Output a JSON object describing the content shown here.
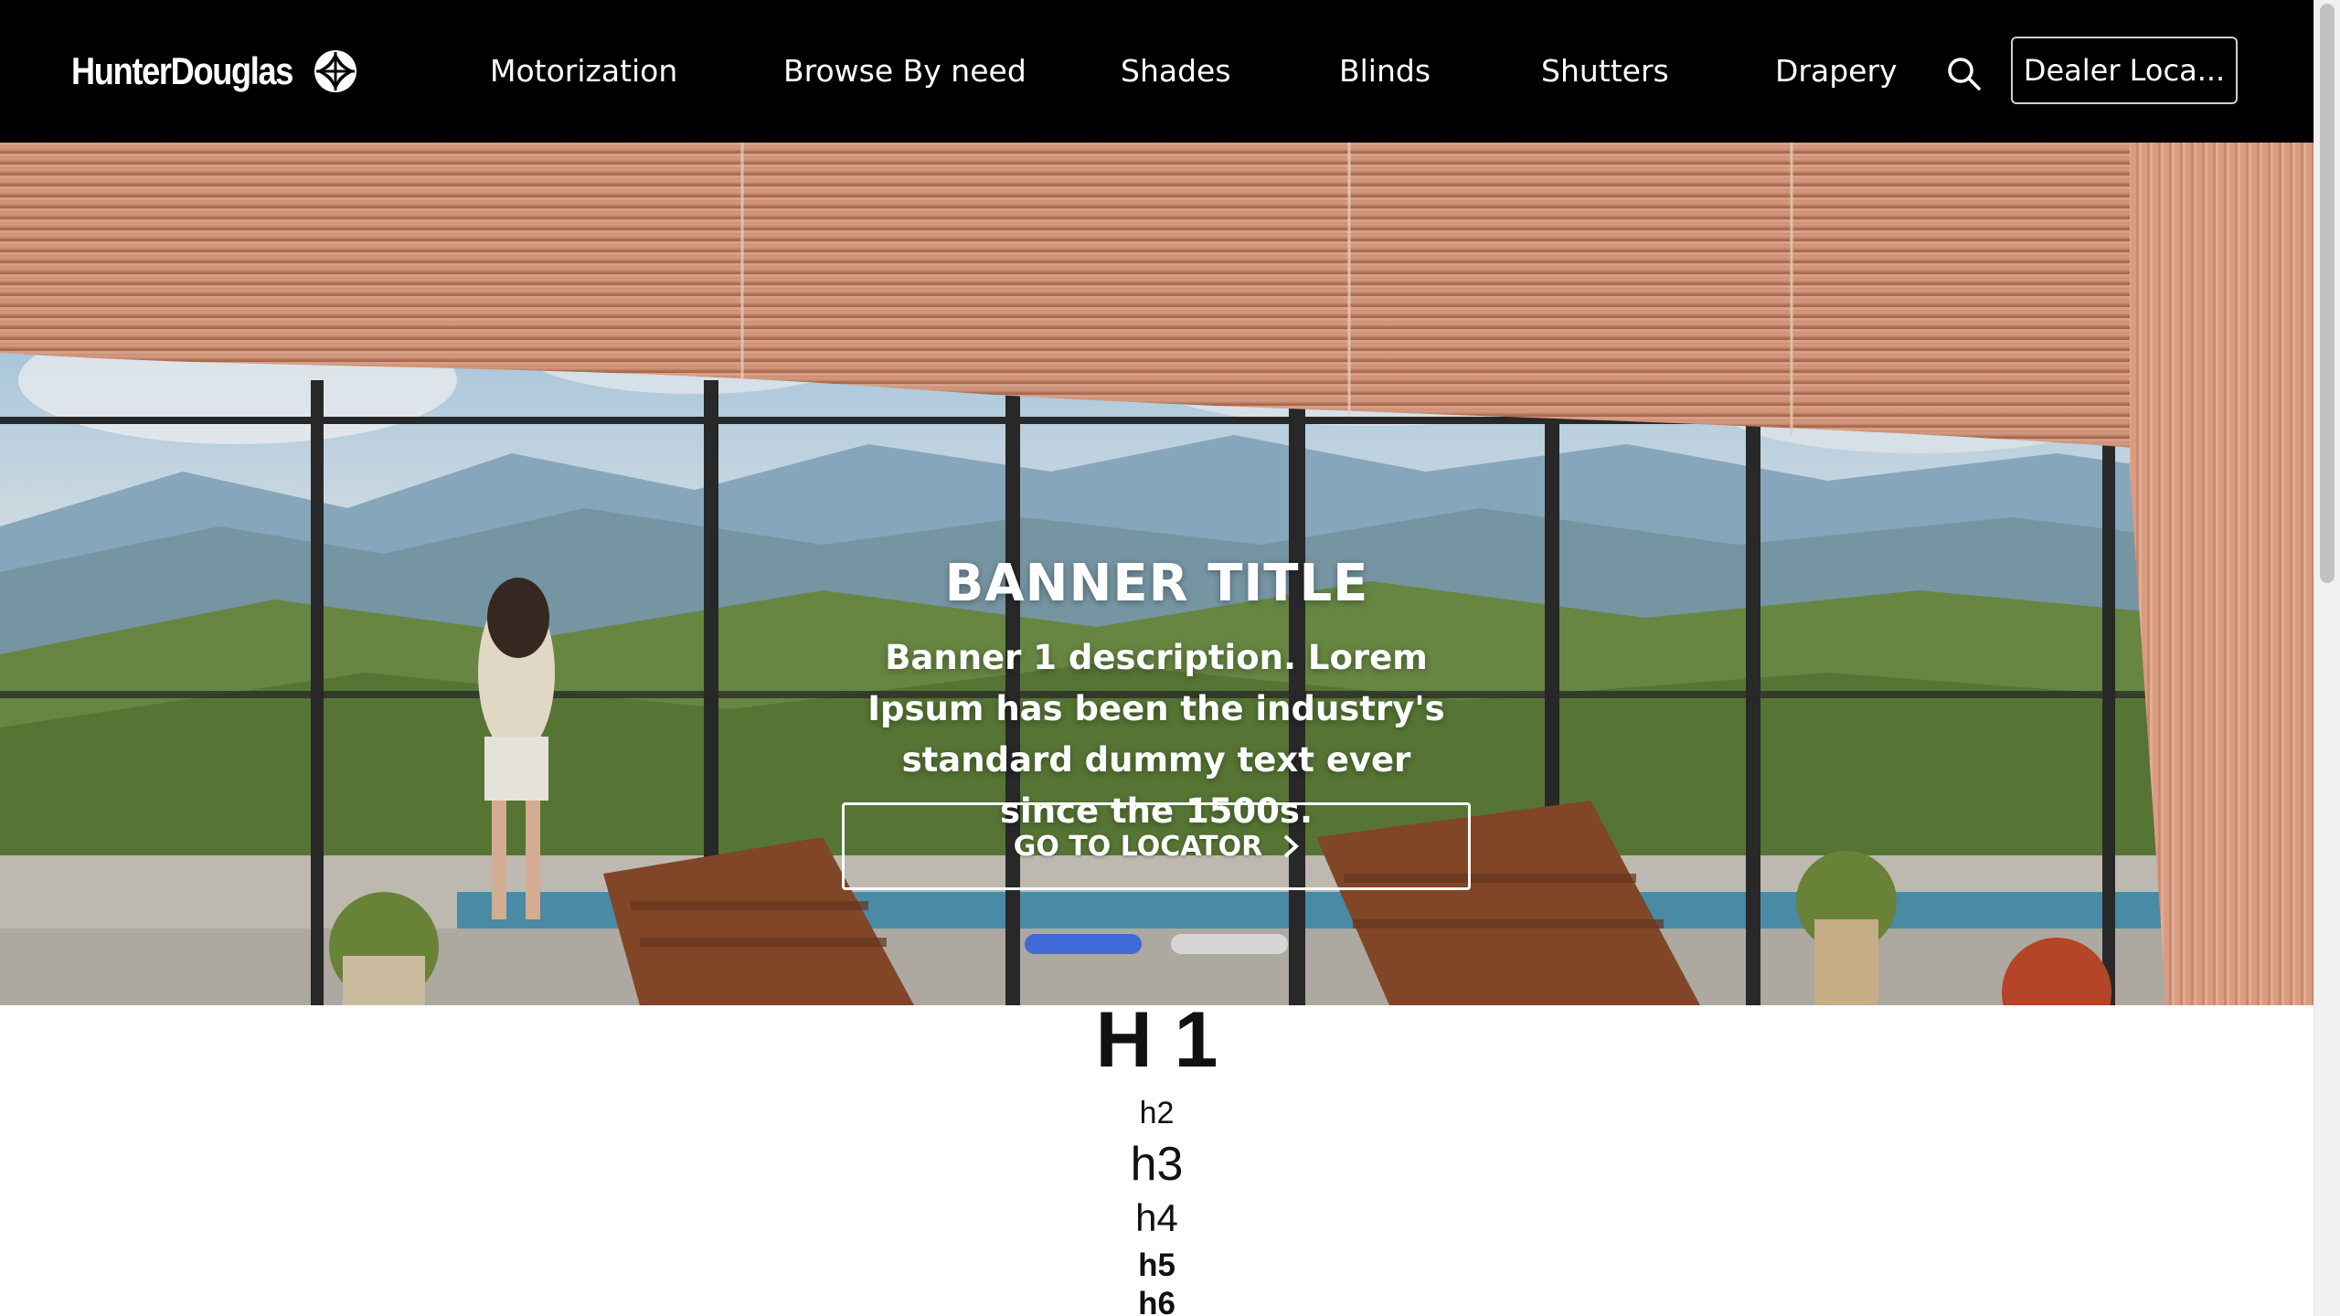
{
  "header": {
    "logo_text": "HunterDouglas",
    "nav": [
      {
        "label": "Motorization"
      },
      {
        "label": "Browse By need"
      },
      {
        "label": "Shades"
      },
      {
        "label": "Blinds"
      },
      {
        "label": "Shutters"
      },
      {
        "label": "Drapery"
      }
    ],
    "search_icon": "search-icon",
    "dealer_button_label": "Dealer Loca..."
  },
  "hero": {
    "title": "BANNER TITLE",
    "description": "Banner 1 description. Lorem Ipsum has been the industry's standard dummy text ever since the 1500s.",
    "cta_label": "GO TO LOCATOR",
    "cta_icon": "chevron-right-icon",
    "slides_total": 2,
    "active_slide": 1
  },
  "headings": {
    "h1": "H 1",
    "h2": "h2",
    "h3": "h3",
    "h4": "h4",
    "h5": "h5",
    "h6": "h6"
  },
  "colors": {
    "header_bg": "#000000",
    "active_dot": "#3f6bd6",
    "inactive_dot": "#d6d6d6",
    "shade": "#d9987c"
  }
}
